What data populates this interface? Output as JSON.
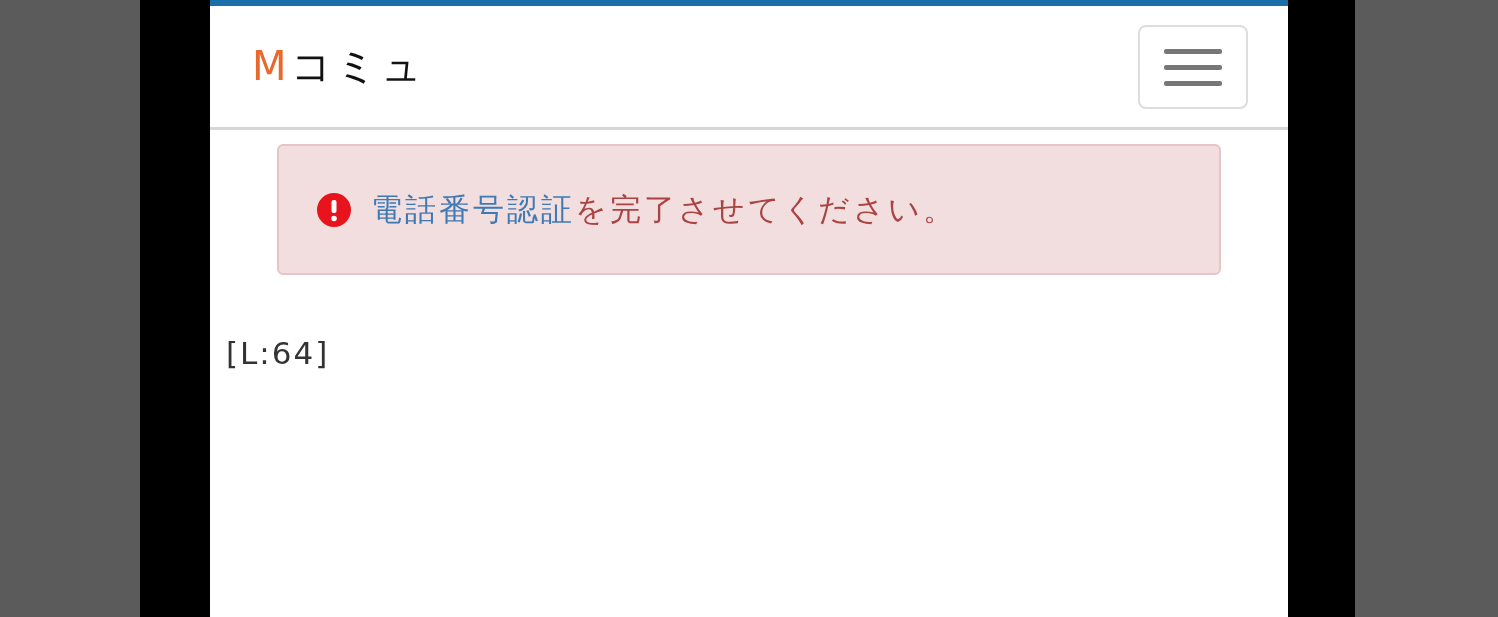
{
  "logo": {
    "accent": "M",
    "text": "コミュ"
  },
  "alert": {
    "link": "電話番号認証",
    "message": "を完了させてください。"
  },
  "footer_text": "[L:64]"
}
